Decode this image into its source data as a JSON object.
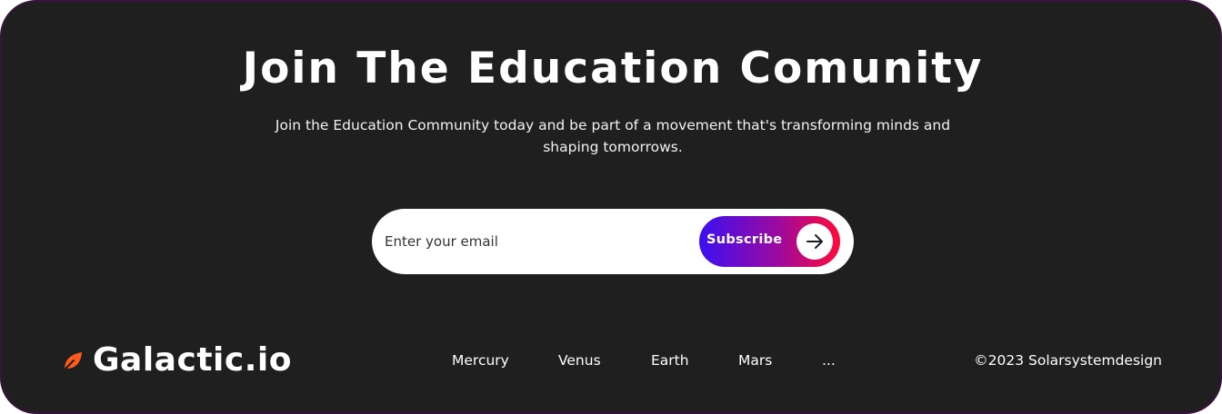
{
  "newsletter": {
    "title": "Join The Education Comunity",
    "subtitle": "Join the Education Community today and be part of a movement that's transforming minds and shaping tomorrows.",
    "email_placeholder": "Enter your email",
    "email_value": "",
    "subscribe_label": "Subscribe",
    "subscribe_icon": "arrow-right-icon"
  },
  "footer": {
    "brand_icon": "leaf-icon",
    "brand_name": "Galactic.io",
    "nav": [
      {
        "label": "Mercury"
      },
      {
        "label": "Venus"
      },
      {
        "label": "Earth"
      },
      {
        "label": "Mars"
      },
      {
        "label": "..."
      }
    ],
    "copyright": "©2023 Solarsystemdesign"
  },
  "colors": {
    "background": "#1f1f1f",
    "border": "#3a1240",
    "gradient_start": "#3b10f0",
    "gradient_end": "#ff0a3a",
    "brand_icon": "#ff5a1f"
  }
}
